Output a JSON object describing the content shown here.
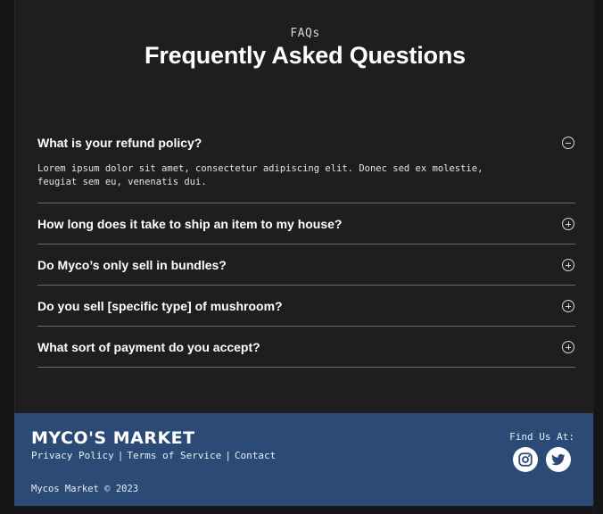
{
  "header": {
    "eyebrow": "FAQs",
    "title": "Frequently Asked Questions"
  },
  "faqs": [
    {
      "question": "What is your refund policy?",
      "answer": "Lorem ipsum dolor sit amet, consectetur adipiscing elit. Donec sed ex molestie, feugiat sem eu, venenatis dui.",
      "expanded": true
    },
    {
      "question": "How long does it take to ship an item to my house?",
      "expanded": false
    },
    {
      "question": "Do Myco’s only sell in bundles?",
      "expanded": false
    },
    {
      "question": "Do you sell [specific type] of mushroom?",
      "expanded": false
    },
    {
      "question": "What sort of payment do you accept?",
      "expanded": false
    }
  ],
  "footer": {
    "brand": "MYCO'S MARKET",
    "links": [
      "Privacy Policy",
      "Terms of Service",
      "Contact"
    ],
    "separator": "|",
    "copyright": "Mycos Market © 2023",
    "find_us": "Find Us At:",
    "social": [
      "instagram-icon",
      "twitter-icon"
    ]
  },
  "colors": {
    "background": "#1e1e1e",
    "footer": "#2b4a75",
    "text": "#ffffff"
  }
}
